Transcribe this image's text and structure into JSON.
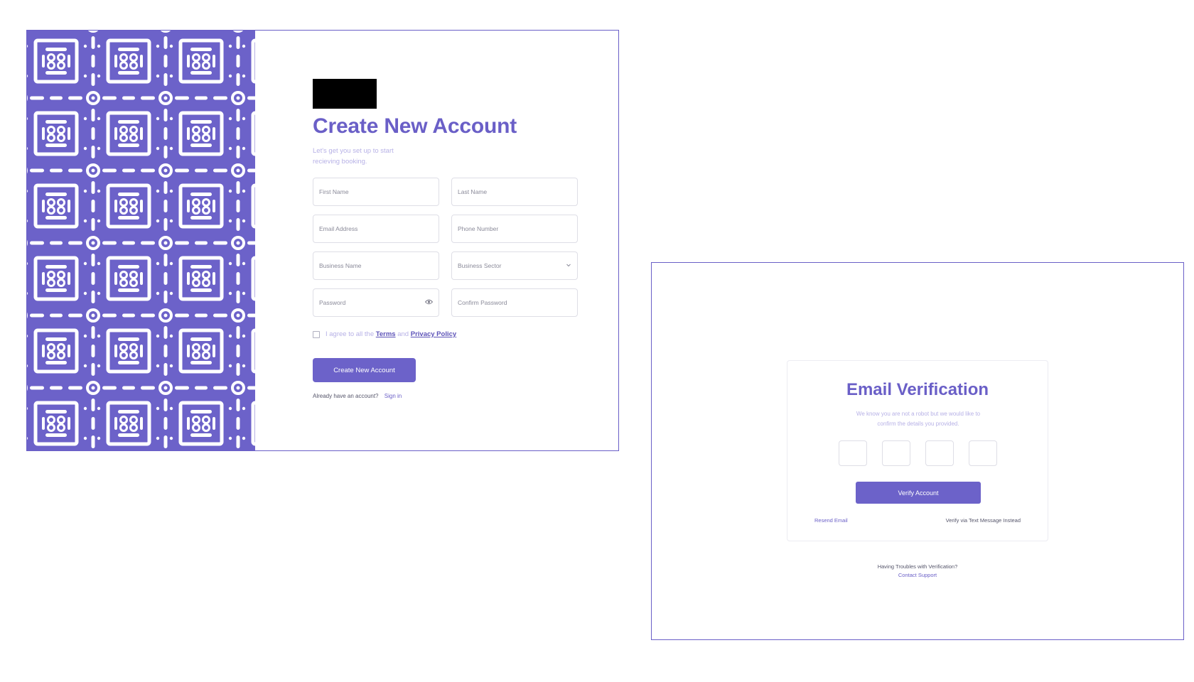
{
  "colors": {
    "accent": "#6c62c9",
    "title": "#6a5fc7",
    "muted": "#b7b1e6",
    "border": "#dedee6"
  },
  "signup": {
    "title": "Create New Account",
    "subtitle": "Let's get you set up to start recieving booking.",
    "fields": {
      "first_name": "First Name",
      "last_name": "Last Name",
      "email": "Email Address",
      "phone": "Phone Number",
      "business_name": "Business Name",
      "business_sector": "Business Sector",
      "password": "Password",
      "confirm_password": "Confirm Password"
    },
    "icons": {
      "sector_dropdown": "chevron-down-icon",
      "password_toggle": "eye-icon"
    },
    "terms": {
      "prefix": "I agree to all the",
      "terms_link": "Terms",
      "conjunction": "and",
      "privacy_link": "Privacy Policy",
      "checked": false
    },
    "submit_label": "Create New Account",
    "signin_prompt": "Already have an account?",
    "signin_link": "Sign in"
  },
  "verification": {
    "title": "Email Verification",
    "subtitle": "We know you are not a robot but we would like to confirm the details you provided.",
    "code_boxes": [
      "",
      "",
      "",
      ""
    ],
    "verify_label": "Verify Account",
    "resend_label": "Resend Email",
    "text_message_label": "Verify via Text Message Instead",
    "trouble_text": "Having Troubles with Verification?",
    "support_link": "Contact Support"
  }
}
